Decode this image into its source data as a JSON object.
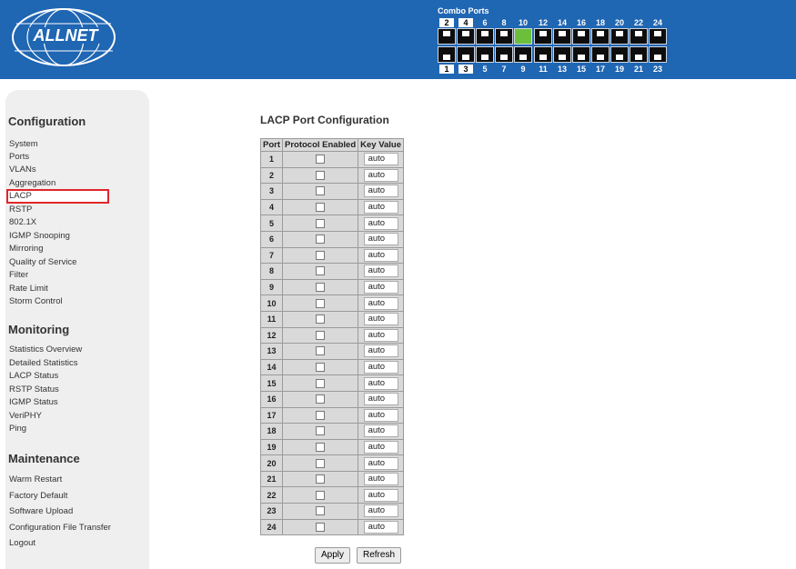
{
  "header": {
    "logo_text": "ALLNET",
    "combo_label": "Combo Ports",
    "top_numbers": [
      "2",
      "4",
      "6",
      "8",
      "10",
      "12",
      "14",
      "16",
      "18",
      "20",
      "22",
      "24"
    ],
    "bottom_numbers": [
      "1",
      "3",
      "5",
      "7",
      "9",
      "11",
      "13",
      "15",
      "17",
      "19",
      "21",
      "23"
    ],
    "active_port": "10"
  },
  "sidebar": {
    "sections": [
      {
        "heading": "Configuration",
        "items": [
          "System",
          "Ports",
          "VLANs",
          "Aggregation",
          "LACP",
          "RSTP",
          "802.1X",
          "IGMP Snooping",
          "Mirroring",
          "Quality of Service",
          "Filter",
          "Rate Limit",
          "Storm Control"
        ]
      },
      {
        "heading": "Monitoring",
        "items": [
          "Statistics Overview",
          "Detailed Statistics",
          "LACP Status",
          "RSTP Status",
          "IGMP Status",
          "VeriPHY",
          "Ping"
        ]
      },
      {
        "heading": "Maintenance",
        "items": [
          "Warm Restart",
          "Factory Default",
          "Software Upload",
          "Configuration File Transfer",
          "Logout"
        ]
      }
    ],
    "selected": "LACP",
    "highlight_color": "#e0262b"
  },
  "main": {
    "title": "LACP Port Configuration",
    "columns": [
      "Port",
      "Protocol Enabled",
      "Key Value"
    ],
    "rows": [
      {
        "port": "1",
        "enabled": false,
        "key": "auto"
      },
      {
        "port": "2",
        "enabled": false,
        "key": "auto"
      },
      {
        "port": "3",
        "enabled": false,
        "key": "auto"
      },
      {
        "port": "4",
        "enabled": false,
        "key": "auto"
      },
      {
        "port": "5",
        "enabled": false,
        "key": "auto"
      },
      {
        "port": "6",
        "enabled": false,
        "key": "auto"
      },
      {
        "port": "7",
        "enabled": false,
        "key": "auto"
      },
      {
        "port": "8",
        "enabled": false,
        "key": "auto"
      },
      {
        "port": "9",
        "enabled": false,
        "key": "auto"
      },
      {
        "port": "10",
        "enabled": false,
        "key": "auto"
      },
      {
        "port": "11",
        "enabled": false,
        "key": "auto"
      },
      {
        "port": "12",
        "enabled": false,
        "key": "auto"
      },
      {
        "port": "13",
        "enabled": false,
        "key": "auto"
      },
      {
        "port": "14",
        "enabled": false,
        "key": "auto"
      },
      {
        "port": "15",
        "enabled": false,
        "key": "auto"
      },
      {
        "port": "16",
        "enabled": false,
        "key": "auto"
      },
      {
        "port": "17",
        "enabled": false,
        "key": "auto"
      },
      {
        "port": "18",
        "enabled": false,
        "key": "auto"
      },
      {
        "port": "19",
        "enabled": false,
        "key": "auto"
      },
      {
        "port": "20",
        "enabled": false,
        "key": "auto"
      },
      {
        "port": "21",
        "enabled": false,
        "key": "auto"
      },
      {
        "port": "22",
        "enabled": false,
        "key": "auto"
      },
      {
        "port": "23",
        "enabled": false,
        "key": "auto"
      },
      {
        "port": "24",
        "enabled": false,
        "key": "auto"
      }
    ],
    "apply_label": "Apply",
    "refresh_label": "Refresh"
  },
  "colors": {
    "header_bg": "#1f66b3",
    "sidebar_bg": "#efefef",
    "table_bg": "#d9d9d9",
    "active_port": "#6bbf3a"
  }
}
